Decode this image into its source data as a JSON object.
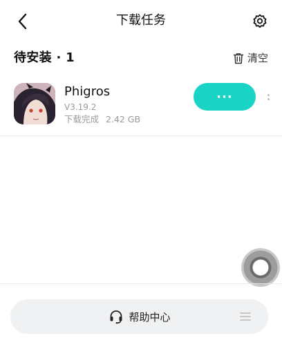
{
  "header": {
    "title": "下载任务",
    "back_icon": "chevron-left-icon",
    "settings_icon": "gear-icon"
  },
  "section": {
    "title": "待安装 · 1",
    "clear_label": "清空",
    "clear_icon": "trash-icon"
  },
  "tasks": [
    {
      "name": "Phigros",
      "version": "V3.19.2",
      "status": "下载完成",
      "size": "2.42 GB",
      "action_label": "···",
      "icon": "app-icon"
    }
  ],
  "floating_button": {
    "icon": "assistive-touch-icon"
  },
  "footer": {
    "help_label": "帮助中心",
    "help_icon": "headset-icon",
    "menu_icon": "menu-icon"
  },
  "colors": {
    "accent": "#19d3c5",
    "secondary_text": "#999999",
    "help_bar_bg": "#f0f1f3"
  }
}
